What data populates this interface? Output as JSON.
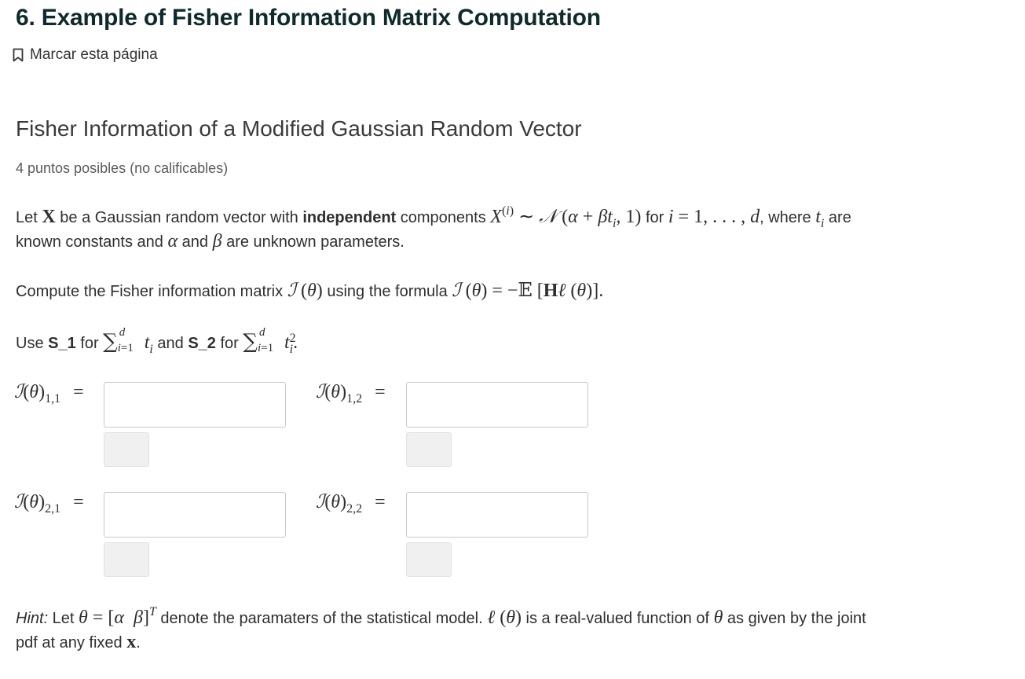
{
  "page": {
    "title": "6. Example of Fisher Information Matrix Computation",
    "bookmark_label": "Marcar esta página"
  },
  "problem": {
    "title": "Fisher Information of a Modified Gaussian Random Vector",
    "points": "4 puntos posibles (no calificables)",
    "intro_let": "Let ",
    "intro_be": " be a Gaussian random vector with ",
    "intro_independent": "independent",
    "intro_components": " components ",
    "intro_for": " for ",
    "intro_where": ", where ",
    "intro_are": " are",
    "intro_line2_a": "known constants and ",
    "intro_line2_and": " and ",
    "intro_line2_b": " are unknown parameters.",
    "compute_a": "Compute the Fisher information matrix ",
    "compute_b": " using the formula ",
    "use_a": "Use ",
    "use_s1": "S_1",
    "use_for1": " for ",
    "use_and": " and ",
    "use_s2": "S_2",
    "use_for2": " for ",
    "hint_label": "Hint:",
    "hint_let": " Let ",
    "hint_denote": " denote the paramaters of the statistical model. ",
    "hint_is": " is a real-valued function of ",
    "hint_as": " as given by the joint",
    "hint_line2": "pdf at any fixed "
  },
  "entries": [
    {
      "label_sub": "1,1",
      "value": "",
      "placeholder": ""
    },
    {
      "label_sub": "1,2",
      "value": "",
      "placeholder": ""
    },
    {
      "label_sub": "2,1",
      "value": "",
      "placeholder": ""
    },
    {
      "label_sub": "2,2",
      "value": "",
      "placeholder": ""
    }
  ],
  "icons": {
    "bookmark": "bookmark-icon"
  }
}
